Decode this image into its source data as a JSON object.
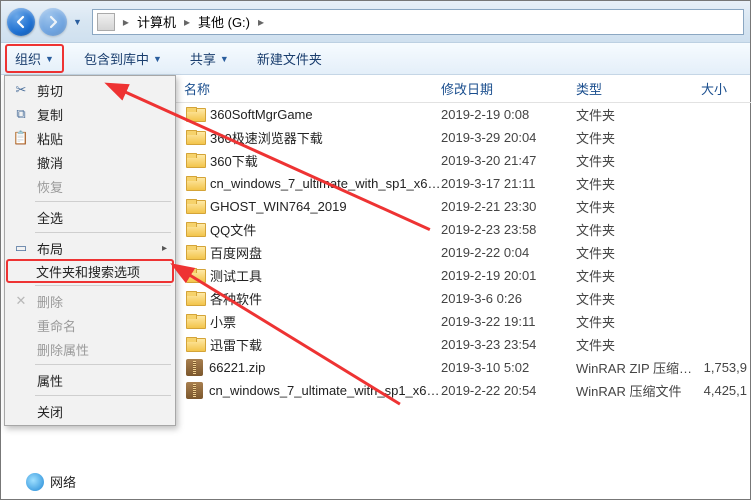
{
  "breadcrumbs": {
    "root": "计算机",
    "folder": "其他 (G:)"
  },
  "toolbar": {
    "organize": "组织",
    "include": "包含到库中",
    "share": "共享",
    "newfolder": "新建文件夹"
  },
  "menu": {
    "cut": "剪切",
    "copy": "复制",
    "paste": "粘贴",
    "undo": "撤消",
    "redo": "恢复",
    "selectall": "全选",
    "layout": "布局",
    "folder_search_options": "文件夹和搜索选项",
    "delete": "删除",
    "rename": "重命名",
    "remove_props": "删除属性",
    "properties": "属性",
    "close": "关闭"
  },
  "tree": {
    "network": "网络"
  },
  "columns": {
    "name": "名称",
    "date": "修改日期",
    "type": "类型",
    "size": "大小"
  },
  "type_labels": {
    "folder": "文件夹",
    "zip": "WinRAR ZIP 压缩…",
    "rar": "WinRAR 压缩文件"
  },
  "files": [
    {
      "icon": "folder",
      "name": "360SoftMgrGame",
      "date": "2019-2-19 0:08",
      "type": "文件夹",
      "size": ""
    },
    {
      "icon": "folder",
      "name": "360极速浏览器下载",
      "date": "2019-3-29 20:04",
      "type": "文件夹",
      "size": ""
    },
    {
      "icon": "folder",
      "name": "360下载",
      "date": "2019-3-20 21:47",
      "type": "文件夹",
      "size": ""
    },
    {
      "icon": "folder",
      "name": "cn_windows_7_ultimate_with_sp1_x6…",
      "date": "2019-3-17 21:11",
      "type": "文件夹",
      "size": ""
    },
    {
      "icon": "folder",
      "name": "GHOST_WIN764_2019",
      "date": "2019-2-21 23:30",
      "type": "文件夹",
      "size": ""
    },
    {
      "icon": "folder",
      "name": "QQ文件",
      "date": "2019-2-23 23:58",
      "type": "文件夹",
      "size": ""
    },
    {
      "icon": "folder",
      "name": "百度网盘",
      "date": "2019-2-22 0:04",
      "type": "文件夹",
      "size": ""
    },
    {
      "icon": "folder",
      "name": "测试工具",
      "date": "2019-2-19 20:01",
      "type": "文件夹",
      "size": ""
    },
    {
      "icon": "folder",
      "name": "各种软件",
      "date": "2019-3-6 0:26",
      "type": "文件夹",
      "size": ""
    },
    {
      "icon": "folder",
      "name": "小票",
      "date": "2019-3-22 19:11",
      "type": "文件夹",
      "size": ""
    },
    {
      "icon": "folder",
      "name": "迅雷下载",
      "date": "2019-3-23 23:54",
      "type": "文件夹",
      "size": ""
    },
    {
      "icon": "zip",
      "name": "66221.zip",
      "date": "2019-3-10 5:02",
      "type": "WinRAR ZIP 压缩…",
      "size": "1,753,9"
    },
    {
      "icon": "zip",
      "name": "cn_windows_7_ultimate_with_sp1_x6…",
      "date": "2019-2-22 20:54",
      "type": "WinRAR 压缩文件",
      "size": "4,425,1"
    }
  ],
  "annotation": {
    "color": "#e33"
  }
}
